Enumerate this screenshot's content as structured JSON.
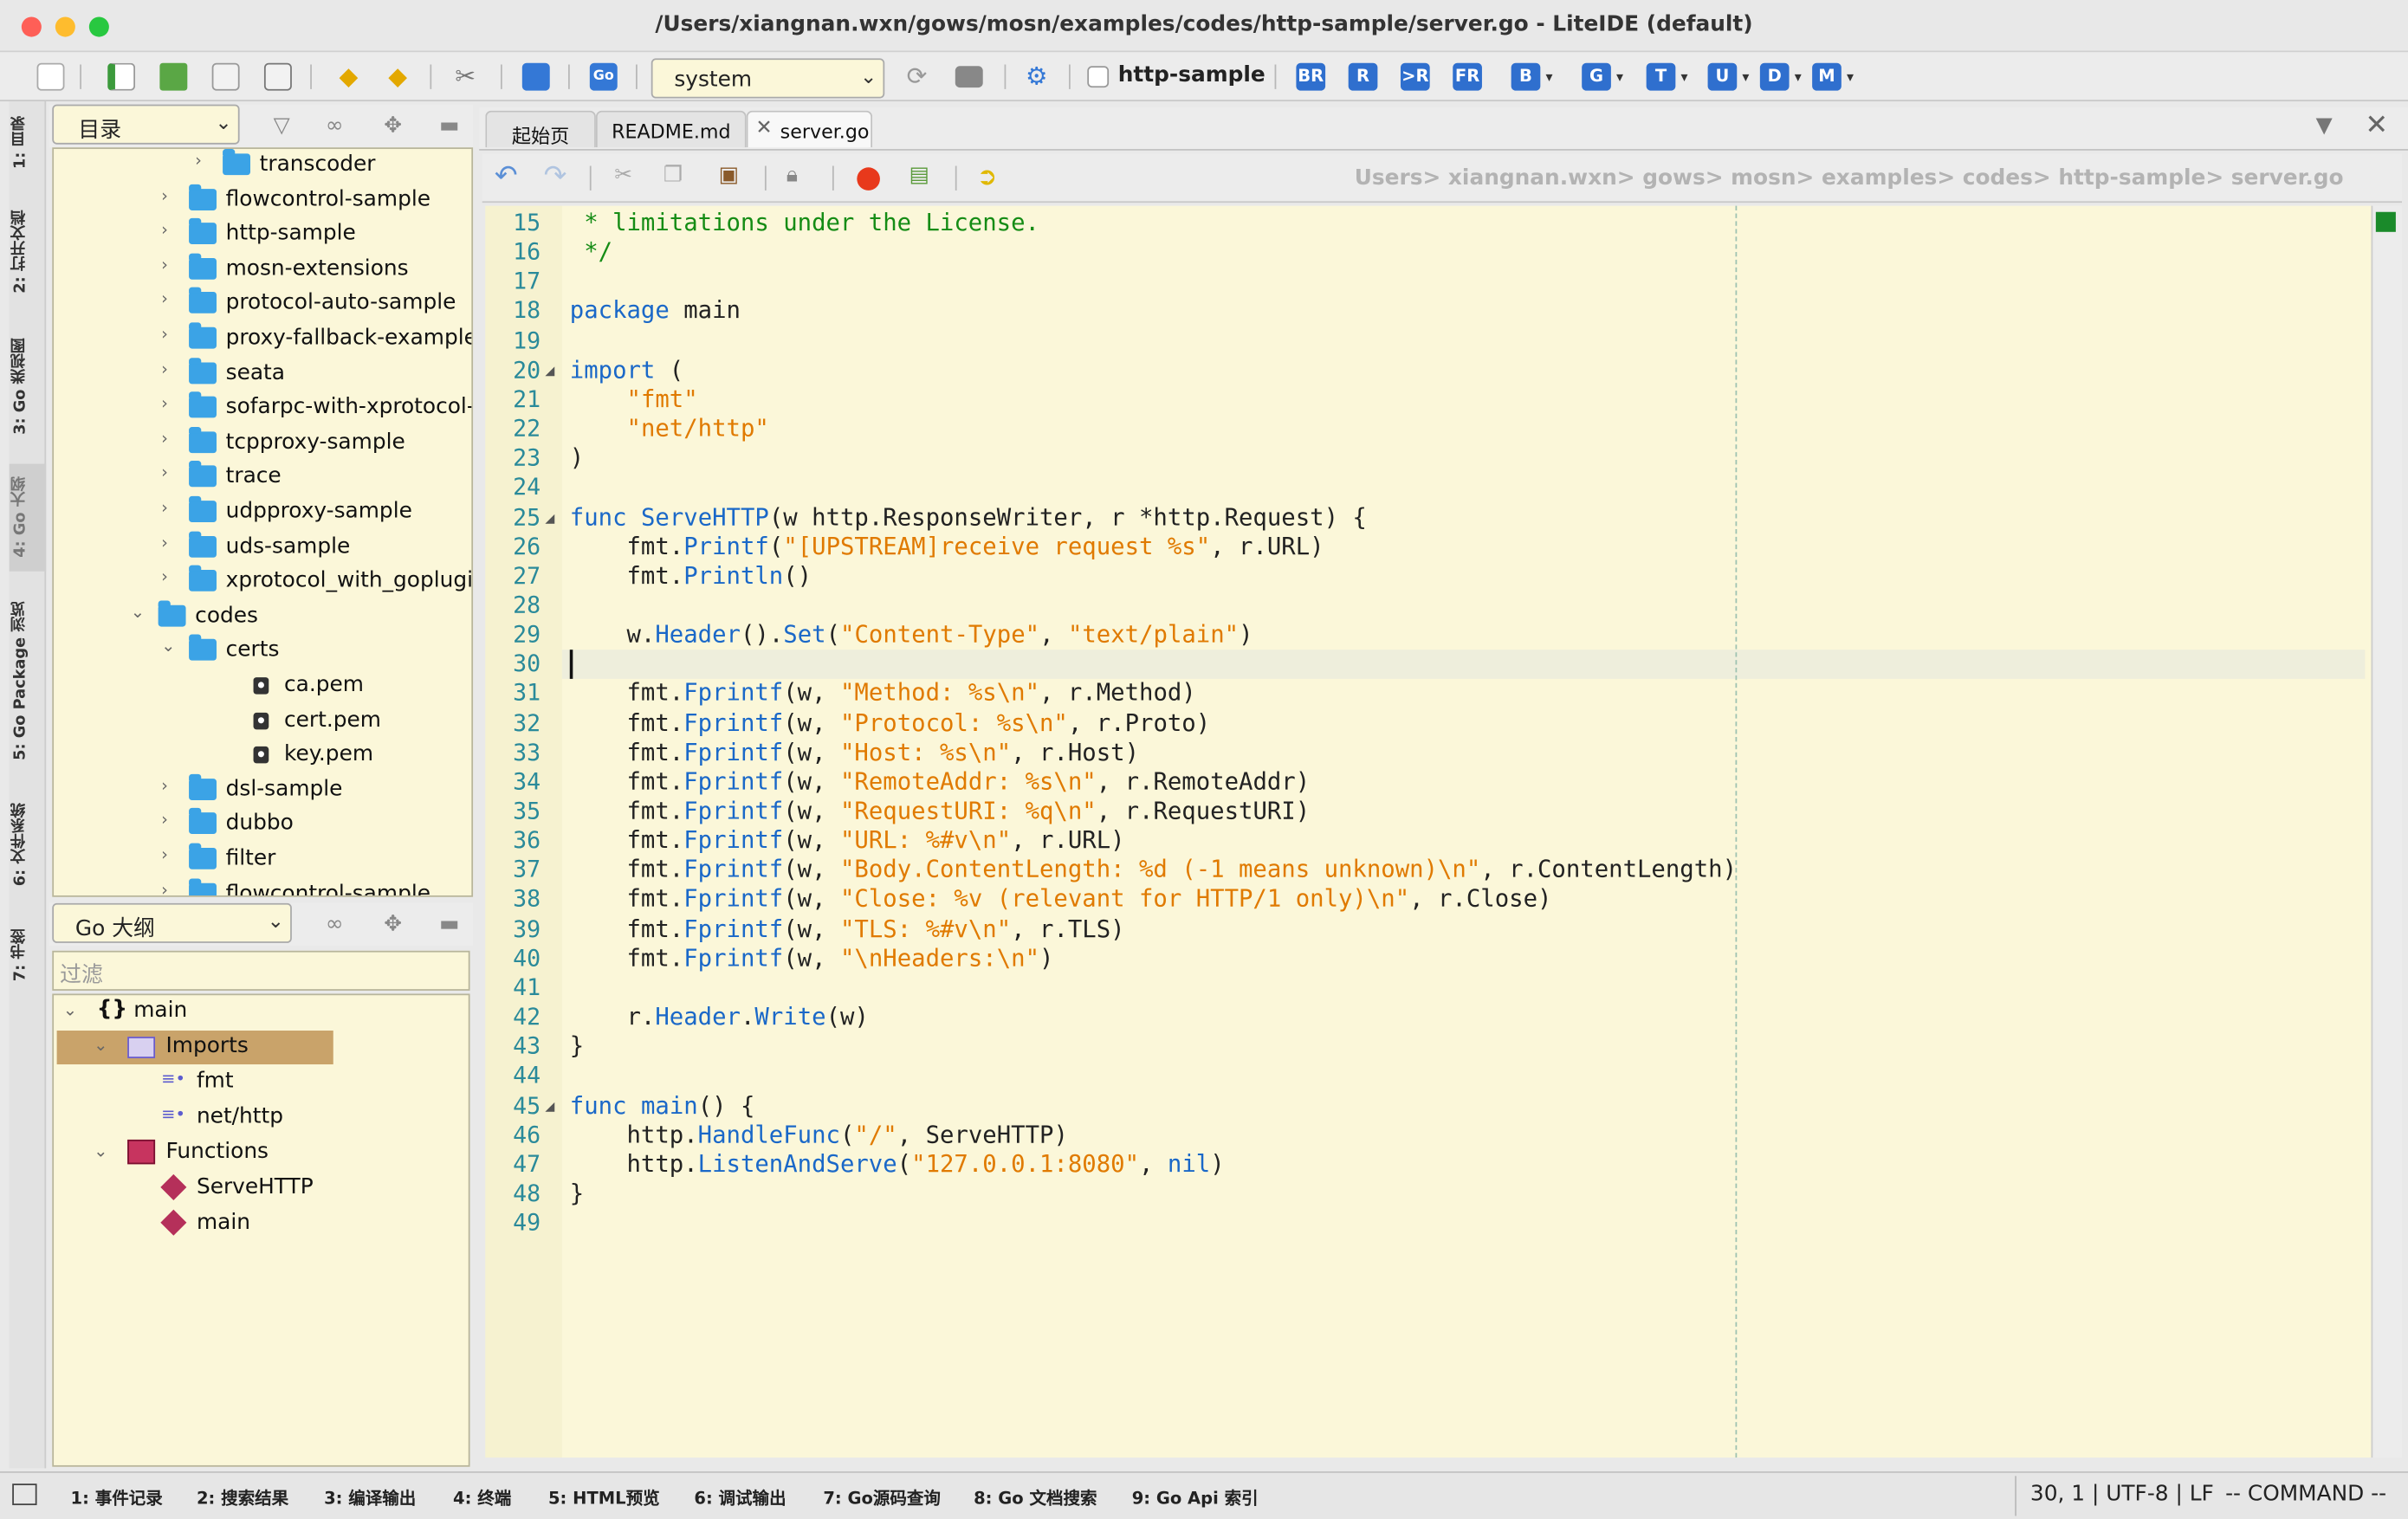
{
  "window": {
    "title": "/Users/xiangnan.wxn/gows/mosn/examples/codes/http-sample/server.go - LiteIDE (default)"
  },
  "toolbar": {
    "env_select": "system",
    "project_label": "http-sample",
    "letter_buttons": [
      "BR",
      "R",
      ">R",
      "FR",
      "B",
      "G",
      "T",
      "U",
      "D",
      "M"
    ]
  },
  "side_tabs": [
    "1: 目录",
    "2: 打开文档",
    "3: Go 类视图",
    "4: Go 大纲",
    "5: Go Package 浏览",
    "6: 文件系统",
    "7: 书签"
  ],
  "directory_panel": {
    "selector": "目录",
    "items": [
      {
        "label": "transcoder",
        "type": "folder"
      },
      {
        "label": "flowcontrol-sample",
        "type": "folder"
      },
      {
        "label": "http-sample",
        "type": "folder"
      },
      {
        "label": "mosn-extensions",
        "type": "folder"
      },
      {
        "label": "protocol-auto-sample",
        "type": "folder"
      },
      {
        "label": "proxy-fallback-example",
        "type": "folder"
      },
      {
        "label": "seata",
        "type": "folder"
      },
      {
        "label": "sofarpc-with-xprotocol-",
        "type": "folder"
      },
      {
        "label": "tcpproxy-sample",
        "type": "folder"
      },
      {
        "label": "trace",
        "type": "folder"
      },
      {
        "label": "udpproxy-sample",
        "type": "folder"
      },
      {
        "label": "uds-sample",
        "type": "folder"
      },
      {
        "label": "xprotocol_with_goplugi",
        "type": "folder"
      },
      {
        "label": "codes",
        "type": "folder"
      },
      {
        "label": "certs",
        "type": "folder"
      },
      {
        "label": "ca.pem",
        "type": "file"
      },
      {
        "label": "cert.pem",
        "type": "file"
      },
      {
        "label": "key.pem",
        "type": "file"
      },
      {
        "label": "dsl-sample",
        "type": "folder"
      },
      {
        "label": "dubbo",
        "type": "folder"
      },
      {
        "label": "filter",
        "type": "folder"
      },
      {
        "label": "flowcontrol-sample",
        "type": "folder"
      }
    ]
  },
  "outline_panel": {
    "selector": "Go 大纲",
    "filter_placeholder": "过滤",
    "items": [
      "main",
      "Imports",
      "fmt",
      "net/http",
      "Functions",
      "ServeHTTP",
      "main"
    ]
  },
  "tabs": [
    "起始页",
    "README.md",
    "server.go"
  ],
  "breadcrumb": "Users> xiangnan.wxn> gows> mosn> examples> codes> http-sample> server.go",
  "code_lines": [
    {
      "n": "15",
      "t": " * limitations under the License."
    },
    {
      "n": "16",
      "t": " */"
    },
    {
      "n": "17",
      "t": ""
    },
    {
      "n": "18",
      "t": "package main"
    },
    {
      "n": "19",
      "t": ""
    },
    {
      "n": "20",
      "t": "import ("
    },
    {
      "n": "21",
      "t": "    \"fmt\""
    },
    {
      "n": "22",
      "t": "    \"net/http\""
    },
    {
      "n": "23",
      "t": ")"
    },
    {
      "n": "24",
      "t": ""
    },
    {
      "n": "25",
      "t": "func ServeHTTP(w http.ResponseWriter, r *http.Request) {"
    },
    {
      "n": "26",
      "t": "    fmt.Printf(\"[UPSTREAM]receive request %s\", r.URL)"
    },
    {
      "n": "27",
      "t": "    fmt.Println()"
    },
    {
      "n": "28",
      "t": ""
    },
    {
      "n": "29",
      "t": "    w.Header().Set(\"Content-Type\", \"text/plain\")"
    },
    {
      "n": "30",
      "t": ""
    },
    {
      "n": "31",
      "t": "    fmt.Fprintf(w, \"Method: %s\\n\", r.Method)"
    },
    {
      "n": "32",
      "t": "    fmt.Fprintf(w, \"Protocol: %s\\n\", r.Proto)"
    },
    {
      "n": "33",
      "t": "    fmt.Fprintf(w, \"Host: %s\\n\", r.Host)"
    },
    {
      "n": "34",
      "t": "    fmt.Fprintf(w, \"RemoteAddr: %s\\n\", r.RemoteAddr)"
    },
    {
      "n": "35",
      "t": "    fmt.Fprintf(w, \"RequestURI: %q\\n\", r.RequestURI)"
    },
    {
      "n": "36",
      "t": "    fmt.Fprintf(w, \"URL: %#v\\n\", r.URL)"
    },
    {
      "n": "37",
      "t": "    fmt.Fprintf(w, \"Body.ContentLength: %d (-1 means unknown)\\n\", r.ContentLength)"
    },
    {
      "n": "38",
      "t": "    fmt.Fprintf(w, \"Close: %v (relevant for HTTP/1 only)\\n\", r.Close)"
    },
    {
      "n": "39",
      "t": "    fmt.Fprintf(w, \"TLS: %#v\\n\", r.TLS)"
    },
    {
      "n": "40",
      "t": "    fmt.Fprintf(w, \"\\nHeaders:\\n\")"
    },
    {
      "n": "41",
      "t": ""
    },
    {
      "n": "42",
      "t": "    r.Header.Write(w)"
    },
    {
      "n": "43",
      "t": "}"
    },
    {
      "n": "44",
      "t": ""
    },
    {
      "n": "45",
      "t": "func main() {"
    },
    {
      "n": "46",
      "t": "    http.HandleFunc(\"/\", ServeHTTP)"
    },
    {
      "n": "47",
      "t": "    http.ListenAndServe(\"127.0.0.1:8080\", nil)"
    },
    {
      "n": "48",
      "t": "}"
    },
    {
      "n": "49",
      "t": ""
    }
  ],
  "status_tabs": [
    "1: 事件记录",
    "2: 搜索结果",
    "3: 编译输出",
    "4: 终端",
    "5: HTML预览",
    "6: 调试输出",
    "7: Go源码查询",
    "8: Go 文档搜索",
    "9: Go Api 索引"
  ],
  "status_position": "30, 1 | UTF-8 | LF",
  "status_mode": "-- COMMAND --",
  "colors": {
    "editor_bg": "#fbf7d9",
    "keyword": "#1a68c8",
    "string": "#e07a00",
    "comment": "#158c15",
    "line_number": "#2a8a9a",
    "selection": "#c9a36a"
  }
}
